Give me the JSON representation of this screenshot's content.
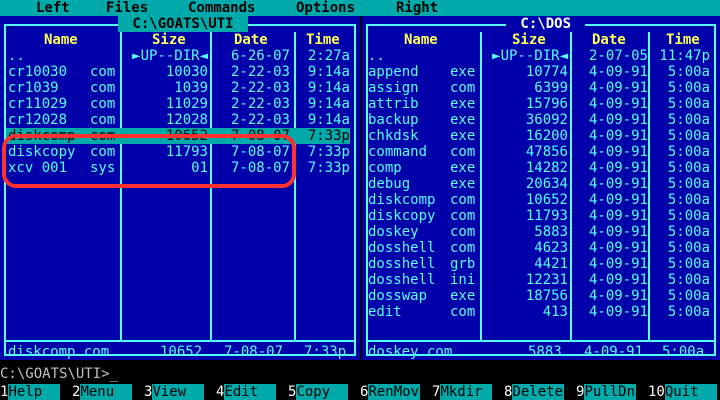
{
  "menu": [
    "Left",
    "Files",
    "Commands",
    "Options",
    "Right"
  ],
  "left_panel": {
    "title": " C:\\GOATS\\UTI ",
    "headers": {
      "name": "Name",
      "size": "Size",
      "date": "Date",
      "time": "Time"
    },
    "files": [
      {
        "name": "..",
        "ext": "",
        "size": "►UP--DIR◄",
        "date": "6-26-07",
        "time": "2:27a"
      },
      {
        "name": "cr10030",
        "ext": "com",
        "size": "10030",
        "date": "2-22-03",
        "time": "9:14a"
      },
      {
        "name": "cr1039",
        "ext": "com",
        "size": "1039",
        "date": "2-22-03",
        "time": "9:14a"
      },
      {
        "name": "cr11029",
        "ext": "com",
        "size": "11029",
        "date": "2-22-03",
        "time": "9:14a"
      },
      {
        "name": "cr12028",
        "ext": "com",
        "size": "12028",
        "date": "2-22-03",
        "time": "9:14a"
      },
      {
        "name": "diskcomp",
        "ext": "com",
        "size": "10652",
        "date": "7-08-07",
        "time": "7:33p"
      },
      {
        "name": "diskcopy",
        "ext": "com",
        "size": "11793",
        "date": "7-08-07",
        "time": "7:33p"
      },
      {
        "name": "xcv 001",
        "ext": "sys",
        "size": "01",
        "date": "7-08-07",
        "time": "7:33p"
      }
    ],
    "cursor_index": 5,
    "info": {
      "file": "diskcomp.com",
      "size": "10652",
      "date": "7-08-07",
      "time": "7:33p"
    }
  },
  "right_panel": {
    "title": " C:\\DOS ",
    "headers": {
      "name": "Name",
      "size": "Size",
      "date": "Date",
      "time": "Time"
    },
    "files": [
      {
        "name": "..",
        "ext": "",
        "size": "►UP--DIR◄",
        "date": "2-07-05",
        "time": "11:47p"
      },
      {
        "name": "append",
        "ext": "exe",
        "size": "10774",
        "date": "4-09-91",
        "time": "5:00a"
      },
      {
        "name": "assign",
        "ext": "com",
        "size": "6399",
        "date": "4-09-91",
        "time": "5:00a"
      },
      {
        "name": "attrib",
        "ext": "exe",
        "size": "15796",
        "date": "4-09-91",
        "time": "5:00a"
      },
      {
        "name": "backup",
        "ext": "exe",
        "size": "36092",
        "date": "4-09-91",
        "time": "5:00a"
      },
      {
        "name": "chkdsk",
        "ext": "exe",
        "size": "16200",
        "date": "4-09-91",
        "time": "5:00a"
      },
      {
        "name": "command",
        "ext": "com",
        "size": "47856",
        "date": "4-09-91",
        "time": "5:00a"
      },
      {
        "name": "comp",
        "ext": "exe",
        "size": "14282",
        "date": "4-09-91",
        "time": "5:00a"
      },
      {
        "name": "debug",
        "ext": "exe",
        "size": "20634",
        "date": "4-09-91",
        "time": "5:00a"
      },
      {
        "name": "diskcomp",
        "ext": "com",
        "size": "10652",
        "date": "4-09-91",
        "time": "5:00a"
      },
      {
        "name": "diskcopy",
        "ext": "com",
        "size": "11793",
        "date": "4-09-91",
        "time": "5:00a"
      },
      {
        "name": "doskey",
        "ext": "com",
        "size": "5883",
        "date": "4-09-91",
        "time": "5:00a"
      },
      {
        "name": "dosshell",
        "ext": "com",
        "size": "4623",
        "date": "4-09-91",
        "time": "5:00a"
      },
      {
        "name": "dosshell",
        "ext": "grb",
        "size": "4421",
        "date": "4-09-91",
        "time": "5:00a"
      },
      {
        "name": "dosshell",
        "ext": "ini",
        "size": "12231",
        "date": "4-09-91",
        "time": "5:00a"
      },
      {
        "name": "dosswap",
        "ext": "exe",
        "size": "18756",
        "date": "4-09-91",
        "time": "5:00a"
      },
      {
        "name": "edit",
        "ext": "com",
        "size": "413",
        "date": "4-09-91",
        "time": "5:00a"
      }
    ],
    "info": {
      "file": "doskey.com",
      "size": "5883",
      "date": "4-09-91",
      "time": "5:00a"
    }
  },
  "command_line": "C:\\GOATS\\UTI>_",
  "function_keys": [
    {
      "num": "1",
      "label": "Help"
    },
    {
      "num": "2",
      "label": "Menu"
    },
    {
      "num": "3",
      "label": "View"
    },
    {
      "num": "4",
      "label": "Edit"
    },
    {
      "num": "5",
      "label": "Copy"
    },
    {
      "num": "6",
      "label": "RenMov"
    },
    {
      "num": "7",
      "label": "Mkdir"
    },
    {
      "num": "8",
      "label": "Delete"
    },
    {
      "num": "9",
      "label": "PullDn"
    },
    {
      "num": "10",
      "label": "Quit"
    }
  ],
  "colors": {
    "panel_bg": "#0000aa",
    "text": "#55ffff",
    "header": "#ffff55",
    "cursor": "#00aaaa",
    "annotation": "#ff3030"
  }
}
